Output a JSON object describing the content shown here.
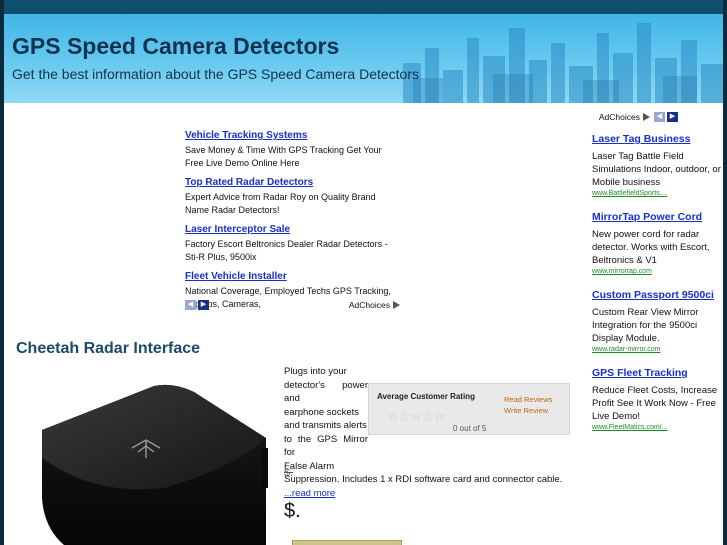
{
  "header": {
    "title": "GPS Speed Camera Detectors",
    "tagline": "Get the best information about the GPS Speed Camera Detectors"
  },
  "ad_block": {
    "items": [
      {
        "title": "Vehicle Tracking Systems",
        "desc": "Save Money & Time With GPS Tracking Get Your Free Live Demo Online Here"
      },
      {
        "title": "Top Rated Radar Detectors",
        "desc": "Expert Advice from Radar Roy on Quality Brand Name Radar Detectors!"
      },
      {
        "title": "Laser Interceptor Sale",
        "desc": "Factory Escort Beltronics Dealer Radar Detectors -Sti-R Plus, 9500ix"
      },
      {
        "title": "Fleet Vehicle Installer",
        "desc": "National Coverage, Employed Techs GPS Tracking, Laptops, Cameras,"
      }
    ],
    "adchoices": "AdChoices"
  },
  "right_ads": {
    "adchoices": "AdChoices",
    "items": [
      {
        "title": "Laser Tag Business",
        "desc": "Laser Tag Battle Field Simulations Indoor, outdoor, or Mobile business",
        "url": "www.BattlefieldSports...."
      },
      {
        "title": "MirrorTap Power Cord",
        "desc": "New power cord for radar detector. Works with Escort, Beltronics & V1",
        "url": "www.mirrortap.com"
      },
      {
        "title": "Custom Passport 9500ci",
        "desc": "Custom Rear View Mirror Integration for the 9500ci Display Module.",
        "url": "www.radar-mirror.com"
      },
      {
        "title": "GPS Fleet Tracking",
        "desc": "Reduce Fleet Costs, Increase Profit See It Work Now - Free Live Demo!",
        "url": "www.FleetMatics.com/..."
      }
    ]
  },
  "product": {
    "title": "Cheetah Radar Interface",
    "desc_narrow": [
      "Plugs into your",
      "detector's power and",
      "earphone sockets",
      "and transmits alerts",
      "to the GPS Mirror for",
      "False Alarm"
    ],
    "desc_full": "Suppression. Includes 1 x RDI software card and connector cable.",
    "read_more": "...read more",
    "rating": {
      "label": "Average Customer Rating",
      "value": "0 out of 5",
      "stars": 0,
      "read_reviews": "Read Reviews",
      "write_review": "Write Review"
    },
    "price_old": "$.",
    "price_new": "$."
  },
  "colors": {
    "link": "#1a2ec8",
    "header_bg": "#4fbce9",
    "title": "#0f3350",
    "product_title": "#1d4a6b",
    "url": "#1f8c2a"
  }
}
